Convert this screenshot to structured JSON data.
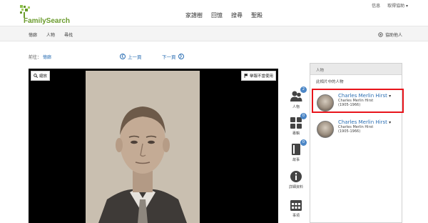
{
  "header": {
    "logo_text": "FamilySearch",
    "user_links": [
      "信息",
      "取得協助 ▾"
    ],
    "nav": [
      "家譜樹",
      "回憶",
      "搜尋",
      "聖殿"
    ]
  },
  "subnav": {
    "items": [
      "憶廊",
      "人物",
      "尋找"
    ],
    "help_label": "協助他人"
  },
  "breadcrumb": {
    "prefix": "前往：",
    "link": "憶廊"
  },
  "pager": {
    "prev": "上一頁",
    "next": "下一頁"
  },
  "viewer": {
    "zoom_label": "縮放",
    "report_label": "舉報不當使用"
  },
  "tools": [
    {
      "icon": "people-icon",
      "label": "人物",
      "badge": "2"
    },
    {
      "icon": "grid-icon",
      "label": "專輯",
      "badge": "0"
    },
    {
      "icon": "book-icon",
      "label": "故事",
      "badge": "0"
    },
    {
      "icon": "info-icon",
      "label": "詳細資料",
      "badge": ""
    },
    {
      "icon": "calendar-icon",
      "label": "事項",
      "badge": ""
    }
  ],
  "panel": {
    "header": "人物",
    "subtitle": "此相片中的人物",
    "people": [
      {
        "name": "Charles Merlin Hirst",
        "alt_name": "Charles Merlin Hirst",
        "years": "(1905-1966)"
      },
      {
        "name": "Charles Merlin Hirst",
        "alt_name": "Charles Merlin Hirst",
        "years": "(1905-1966)"
      }
    ]
  },
  "colors": {
    "brand_green": "#6a9b2c",
    "link_blue": "#2a6eb3",
    "highlight_red": "#e8141b",
    "badge_blue": "#4b86c6"
  }
}
